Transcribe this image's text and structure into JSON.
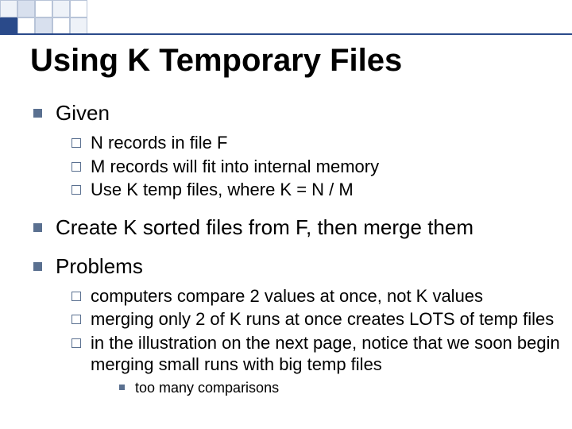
{
  "title": "Using K Temporary Files",
  "bullets": {
    "b1": {
      "label": "Given",
      "sub": {
        "s1": "N records in file F",
        "s2": "M records will fit into internal memory",
        "s3": "Use K temp files, where K = N / M"
      }
    },
    "b2": {
      "label": "Create K sorted files from F, then merge them"
    },
    "b3": {
      "label": "Problems",
      "sub": {
        "s1": "computers compare 2 values at once, not K values",
        "s2": "merging only 2 of K runs at once creates LOTS of temp files",
        "s3": "in the illustration on the next page, notice that we soon begin merging small runs with big temp files",
        "s3sub": {
          "t1": "too many comparisons"
        }
      }
    }
  }
}
